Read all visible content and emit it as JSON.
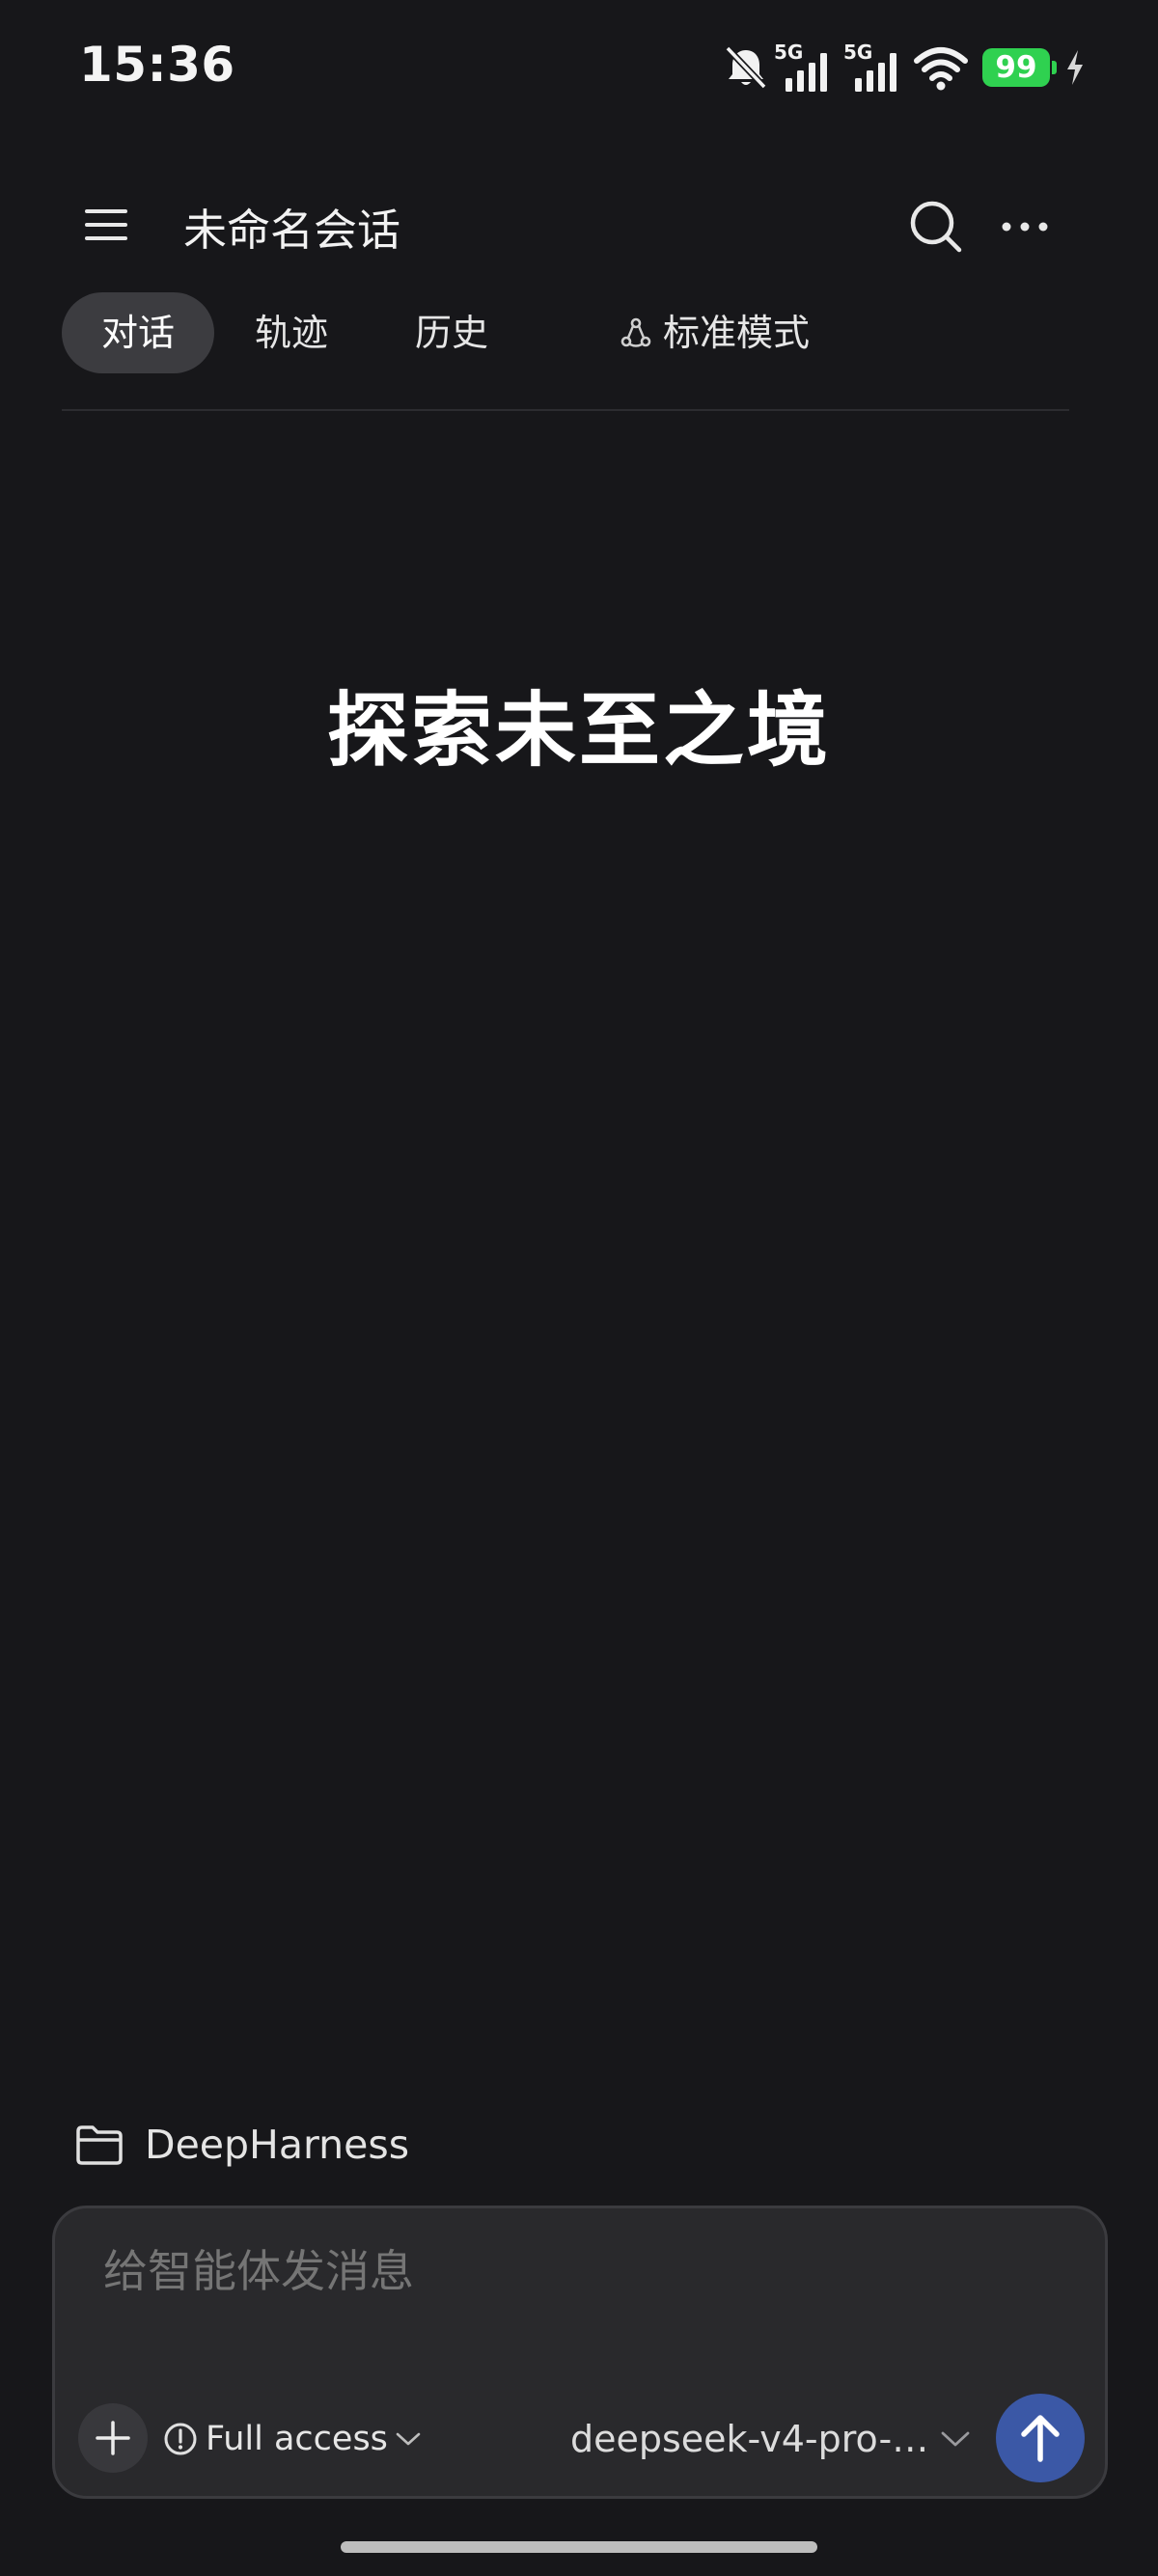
{
  "status_bar": {
    "time": "15:36",
    "network_1": "5G",
    "network_2": "5G",
    "battery_level": "99",
    "icons": [
      "bell-muted-icon",
      "signal-icon",
      "signal-icon",
      "wifi-icon",
      "battery-icon",
      "charging-icon"
    ],
    "battery_color": "#2fd150"
  },
  "header": {
    "title": "未命名会话",
    "icons": [
      "menu-icon",
      "search-icon",
      "more-icon"
    ]
  },
  "tabs": [
    {
      "label": "对话",
      "active": true
    },
    {
      "label": "轨迹",
      "active": false
    },
    {
      "label": "历史",
      "active": false
    },
    {
      "label": "标准模式",
      "active": false,
      "icon": "mode-icon"
    }
  ],
  "hero": {
    "text": "探索未至之境"
  },
  "workspace": {
    "label": "DeepHarness",
    "icon": "folder-icon"
  },
  "composer": {
    "placeholder": "给智能体发消息",
    "access_label": "Full access",
    "model_label": "deepseek-v4-pro-…",
    "accent_color": "#3b58a6"
  }
}
